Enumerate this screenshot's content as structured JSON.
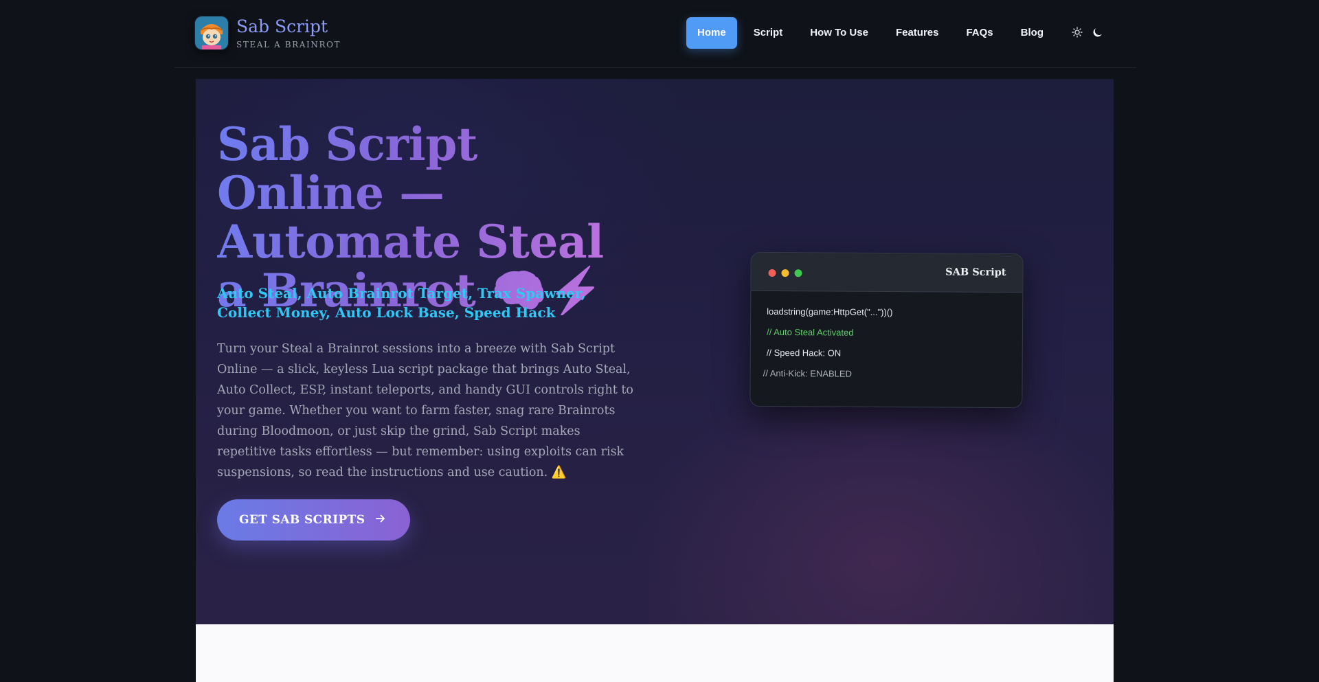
{
  "header": {
    "brand_title": "Sab Script",
    "brand_subtitle": "STEAL A BRAINROT",
    "nav": [
      {
        "label": "Home",
        "active": true
      },
      {
        "label": "Script"
      },
      {
        "label": "How To Use"
      },
      {
        "label": "Features"
      },
      {
        "label": "FAQs"
      },
      {
        "label": "Blog"
      }
    ],
    "theme_icons": [
      "sun-icon",
      "moon-icon"
    ]
  },
  "hero": {
    "title": "Sab Script Online — Automate Steal a Brainrot 🧠⚡",
    "subtitle": "Auto Steal, Auto Brainrot Target, Trax Spawner, Collect Money, Auto Lock Base, Speed Hack",
    "description": "Turn your Steal a Brainrot sessions into a breeze with Sab Script Online — a slick, keyless Lua script package that brings Auto Steal, Auto Collect, ESP, instant teleports, and handy GUI controls right to your game. Whether you want to farm faster, snag rare Brainrots during Bloodmoon, or just skip the grind, Sab Script makes repetitive tasks effortless — but remember: using exploits can risk suspensions, so read the instructions and use caution. ⚠️",
    "cta_label": "GET SAB SCRIPTS",
    "cta_icon": "arrow-right-icon"
  },
  "code_window": {
    "title": "SAB Script",
    "lines": [
      "loadstring(game:HttpGet(\"...\"))()",
      "// Auto Steal Activated",
      "// Speed Hack: ON",
      "// Anti-Kick: ENABLED"
    ]
  },
  "colors": {
    "accent_blue": "#4f9bf5",
    "brand": "#8c9cf7",
    "subtitle_cyan": "#2ec8f3",
    "cta_start": "#6a7be6",
    "cta_end": "#8a62d3"
  }
}
